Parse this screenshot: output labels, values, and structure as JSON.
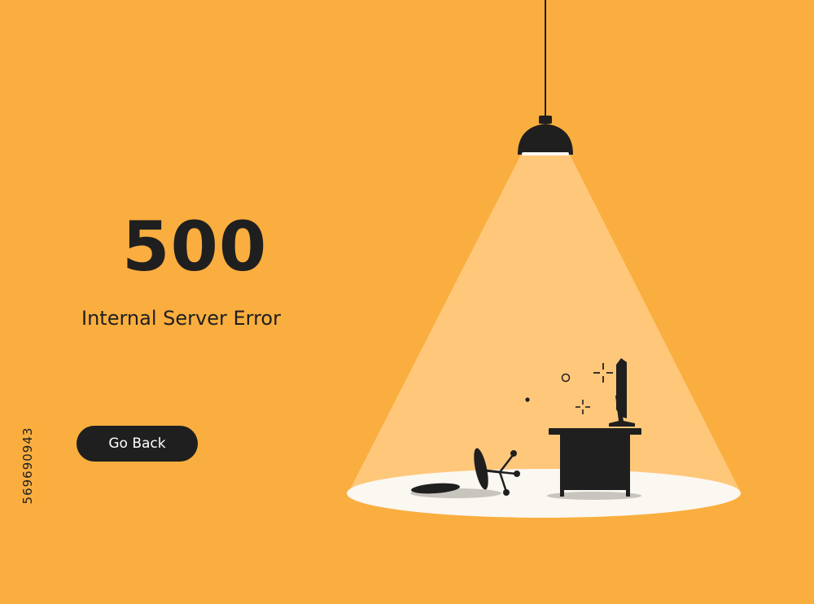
{
  "error": {
    "code": "500",
    "message": "Internal Server Error"
  },
  "actions": {
    "go_back_label": "Go Back"
  },
  "watermark": {
    "stock_id": "569690943"
  },
  "colors": {
    "background": "#FAAE3F",
    "light_beam": "#FFC77A",
    "floor_light": "#FBF7F1",
    "dark": "#1F1F1F",
    "button_text": "#FFFFFF",
    "shadow": "#C8C4BE"
  },
  "icons": {
    "lamp": "ceiling-lamp-icon",
    "desk": "desk-icon",
    "monitor": "monitor-icon",
    "chair": "fallen-chair-icon",
    "sparkles": "sparkle-icon"
  }
}
